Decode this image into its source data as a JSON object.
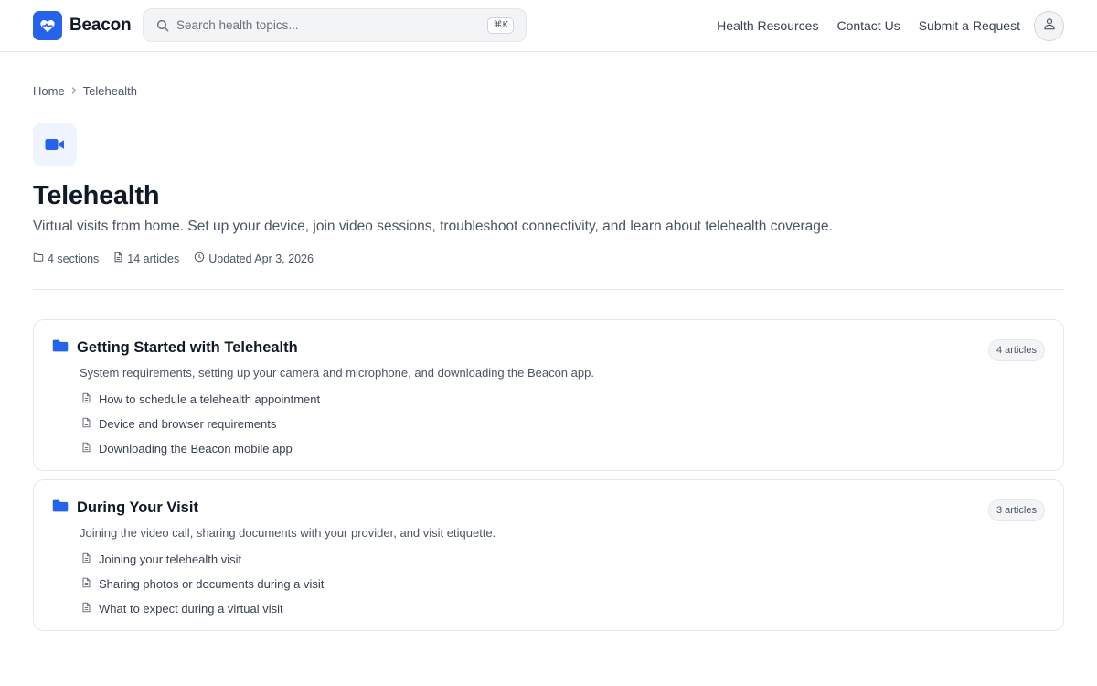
{
  "header": {
    "brand": "Beacon",
    "search_placeholder": "Search health topics...",
    "search_shortcut": "⌘K",
    "nav": [
      "Health Resources",
      "Contact Us",
      "Submit a Request"
    ]
  },
  "breadcrumb": {
    "home": "Home",
    "current": "Telehealth"
  },
  "page": {
    "title": "Telehealth",
    "description": "Virtual visits from home. Set up your device, join video sessions, troubleshoot connectivity, and learn about telehealth coverage.",
    "sections_count": "4 sections",
    "articles_count": "14 articles",
    "updated": "Updated Apr 3, 2026"
  },
  "sections": [
    {
      "title": "Getting Started with Telehealth",
      "badge": "4 articles",
      "description": "System requirements, setting up your camera and microphone, and downloading the Beacon app.",
      "articles": [
        "How to schedule a telehealth appointment",
        "Device and browser requirements",
        "Downloading the Beacon mobile app"
      ]
    },
    {
      "title": "During Your Visit",
      "badge": "3 articles",
      "description": "Joining the video call, sharing documents with your provider, and visit etiquette.",
      "articles": [
        "Joining your telehealth visit",
        "Sharing photos or documents during a visit",
        "What to expect during a virtual visit"
      ]
    }
  ],
  "colors": {
    "accent": "#2563eb",
    "accent_bg": "#eff4ff",
    "text": "#111827",
    "muted": "#4b5563",
    "border": "#e5e7eb"
  },
  "icons": [
    "heart-pulse-icon",
    "search-icon",
    "user-icon",
    "chevron-right-icon",
    "video-camera-icon",
    "folder-outline-icon",
    "document-icon",
    "clock-icon",
    "folder-icon"
  ]
}
